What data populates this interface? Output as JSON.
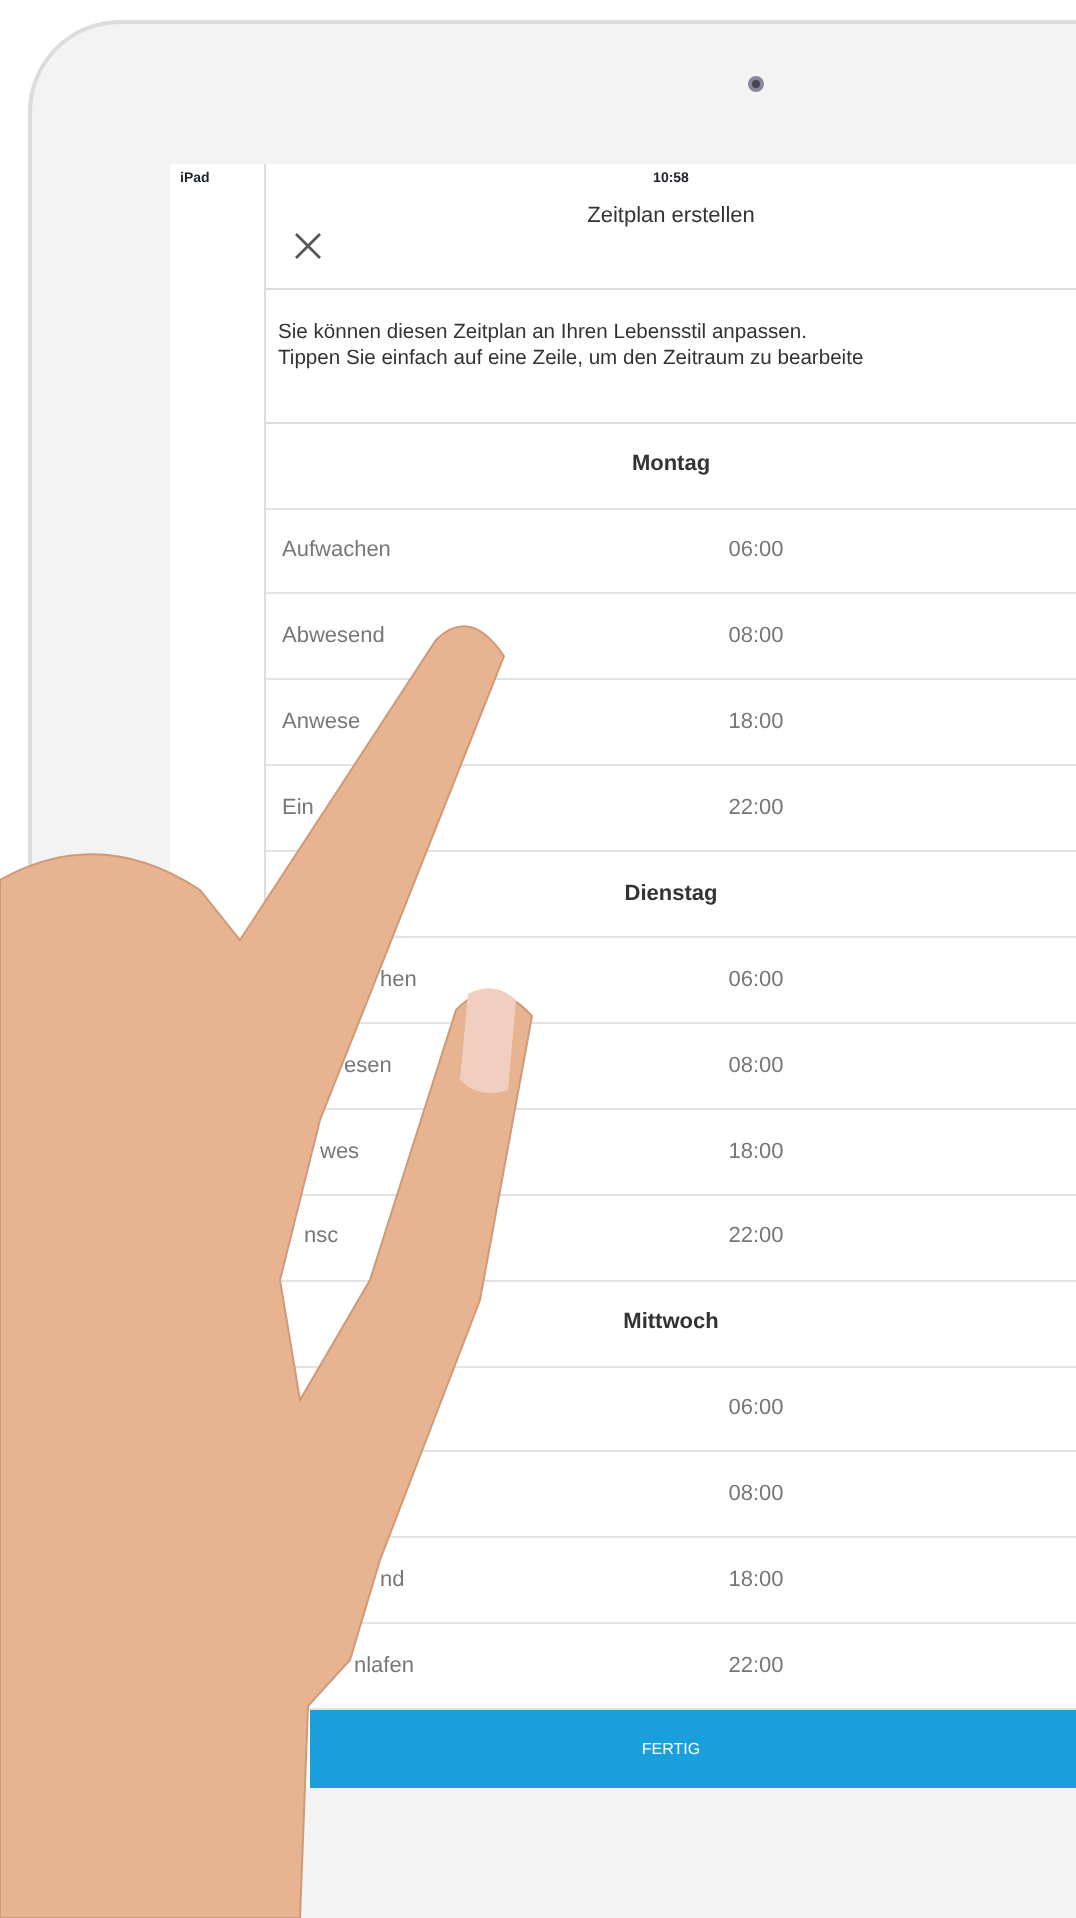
{
  "status_bar": {
    "carrier": "iPad",
    "time": "10:58"
  },
  "header": {
    "title": "Zeitplan erstellen"
  },
  "description": "Sie können diesen Zeitplan an Ihren Lebensstil anpassen.\nTippen Sie einfach auf eine Zeile, um den Zeitraum zu bearbeite",
  "days": [
    {
      "name": "Montag",
      "rows": [
        {
          "label": "Aufwachen",
          "time": "06:00"
        },
        {
          "label": "Abwesend",
          "time": "08:00"
        },
        {
          "label": "Anwese",
          "time": "18:00"
        },
        {
          "label": "Ein",
          "time": "22:00"
        }
      ]
    },
    {
      "name": "Dienstag",
      "rows": [
        {
          "label": "hen",
          "time": "06:00"
        },
        {
          "label": "esen",
          "time": "08:00"
        },
        {
          "label": "wes",
          "time": "18:00"
        },
        {
          "label": "nsc",
          "time": "22:00"
        }
      ]
    },
    {
      "name": "Mittwoch",
      "rows": [
        {
          "time": "06:00"
        },
        {
          "time": "08:00"
        },
        {
          "label": "nd",
          "time": "18:00"
        },
        {
          "label": "nlafen",
          "time": "22:00"
        }
      ]
    }
  ],
  "done_button": "FERTIG"
}
